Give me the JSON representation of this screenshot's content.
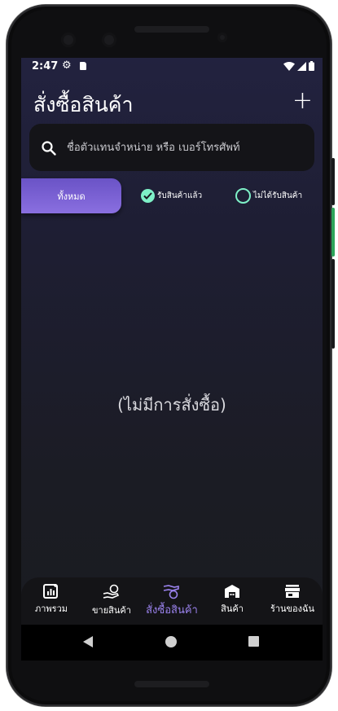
{
  "status_bar": {
    "time": "2:47"
  },
  "header": {
    "title": "สั่งซื้อสินค้า",
    "add_label": "+"
  },
  "search": {
    "placeholder": "ชื่อตัวแทนจำหน่าย หรือ เบอร์โทรศัพท์",
    "value": ""
  },
  "filters": {
    "all_label": "ทั้งหมด",
    "received_label": "รับสินค้าแล้ว",
    "not_received_label": "ไม่ได้รับสินค้า",
    "active": "all"
  },
  "empty_state": {
    "message": "(ไม่มีการสั่งซื้อ)"
  },
  "bottom_nav": {
    "items": [
      {
        "label": "ภาพรวม",
        "icon": "chart-icon"
      },
      {
        "label": "ขายสินค้า",
        "icon": "hand-coin-icon"
      },
      {
        "label": "สั่งซื้อสินค้า",
        "icon": "order-coin-icon"
      },
      {
        "label": "สินค้า",
        "icon": "warehouse-icon"
      },
      {
        "label": "ร้านของฉัน",
        "icon": "store-icon"
      }
    ],
    "active_index": 2
  },
  "colors": {
    "accent": "#8a6fe0",
    "check": "#7ef0c7",
    "background_top": "#22223f",
    "background_bottom": "#1a1b20"
  }
}
